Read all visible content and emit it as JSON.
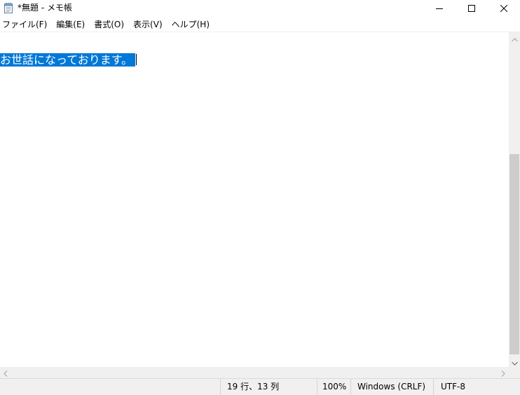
{
  "window": {
    "title": "*無題 - メモ帳",
    "icon": "notepad-icon",
    "controls": [
      "minimize-icon",
      "maximize-icon",
      "close-icon"
    ]
  },
  "menu": {
    "items": [
      {
        "label": "ファイル(F)"
      },
      {
        "label": "編集(E)"
      },
      {
        "label": "書式(O)"
      },
      {
        "label": "表示(V)"
      },
      {
        "label": "ヘルプ(H)"
      }
    ]
  },
  "editor": {
    "selected_text": "お世話になっております。"
  },
  "statusbar": {
    "position": "19 行、13 列",
    "zoom": "100%",
    "line_ending": "Windows (CRLF)",
    "encoding": "UTF-8"
  },
  "colors": {
    "selection": "#0078d7",
    "chrome": "#f0f0f0",
    "scroll_thumb": "#cdcdcd"
  }
}
